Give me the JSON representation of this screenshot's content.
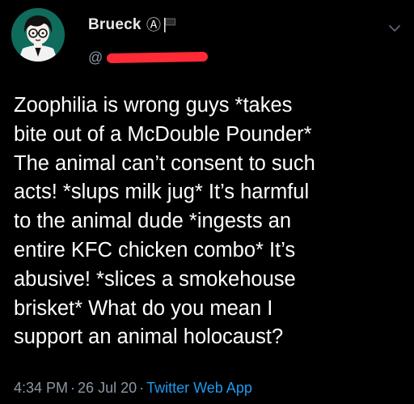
{
  "tweet": {
    "author": {
      "display_name": "Brueck",
      "badge_symbol": "Ⓐ",
      "handle_prefix": "@",
      "avatar_icon": "cartoon-boy-with-glasses",
      "badge_icons": [
        "anarchy-icon",
        "black-flag-icon"
      ]
    },
    "text": "Zoophilia is wrong guys *takes\nbite out of a McDouble Pounder*\nThe animal can’t consent to such\nacts! *slups milk jug* It’s harmful\nto the animal dude *ingests an\nentire KFC chicken combo* It’s\nabusive! *slices a smokehouse\nbrisket* What do you mean I\nsupport an animal holocaust?",
    "time": "4:34 PM",
    "separator": "·",
    "date": "26 Jul 20",
    "source": "Twitter Web App"
  },
  "colors": {
    "background": "#000000",
    "text": "#ffffff",
    "secondary_text": "#8b98a5",
    "link": "#1d9bf0",
    "redaction": "#ff2a35"
  }
}
